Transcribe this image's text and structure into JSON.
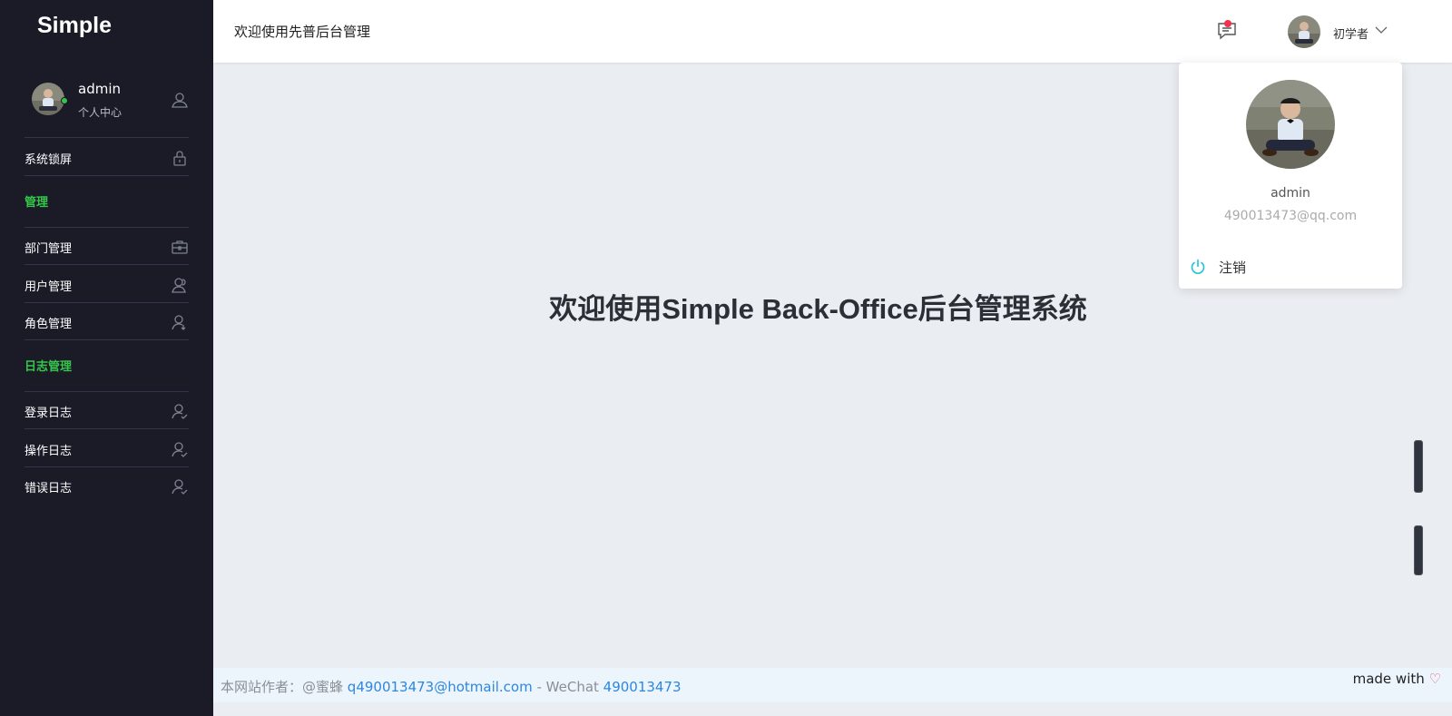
{
  "sidebar": {
    "brand": "Simple",
    "profile": {
      "name": "admin",
      "subtitle": "个人中心",
      "status": "online"
    },
    "lock_item": {
      "label": "系统锁屏",
      "icon": "lock-icon"
    },
    "sections": [
      {
        "title": "管理",
        "items": [
          {
            "label": "部门管理",
            "icon": "briefcase-icon"
          },
          {
            "label": "用户管理",
            "icon": "user-group-icon"
          },
          {
            "label": "角色管理",
            "icon": "user-down-icon"
          }
        ]
      },
      {
        "title": "日志管理",
        "items": [
          {
            "label": "登录日志",
            "icon": "user-check-icon"
          },
          {
            "label": "操作日志",
            "icon": "user-check-icon"
          },
          {
            "label": "错误日志",
            "icon": "user-check-icon"
          }
        ]
      }
    ]
  },
  "header": {
    "title": "欢迎使用先普后台管理",
    "user_name": "初学者",
    "has_unread_messages": true
  },
  "main": {
    "welcome": "欢迎使用Simple Back-Office后台管理系统"
  },
  "user_dropdown": {
    "name": "admin",
    "email": "490013473@qq.com",
    "logout_label": "注销"
  },
  "footer": {
    "author_prefix": "本网站作者：@蜜蜂",
    "email": "q490013473@hotmail.com",
    "wechat_sep": " - WeChat ",
    "wechat": "490013473",
    "made_with": "made with"
  },
  "colors": {
    "sidebar_bg": "#1b1b27",
    "accent_green": "#35c74a",
    "link_blue": "#2d86e0",
    "badge_red": "#f0324d",
    "logout_cyan": "#1ec3d6"
  }
}
